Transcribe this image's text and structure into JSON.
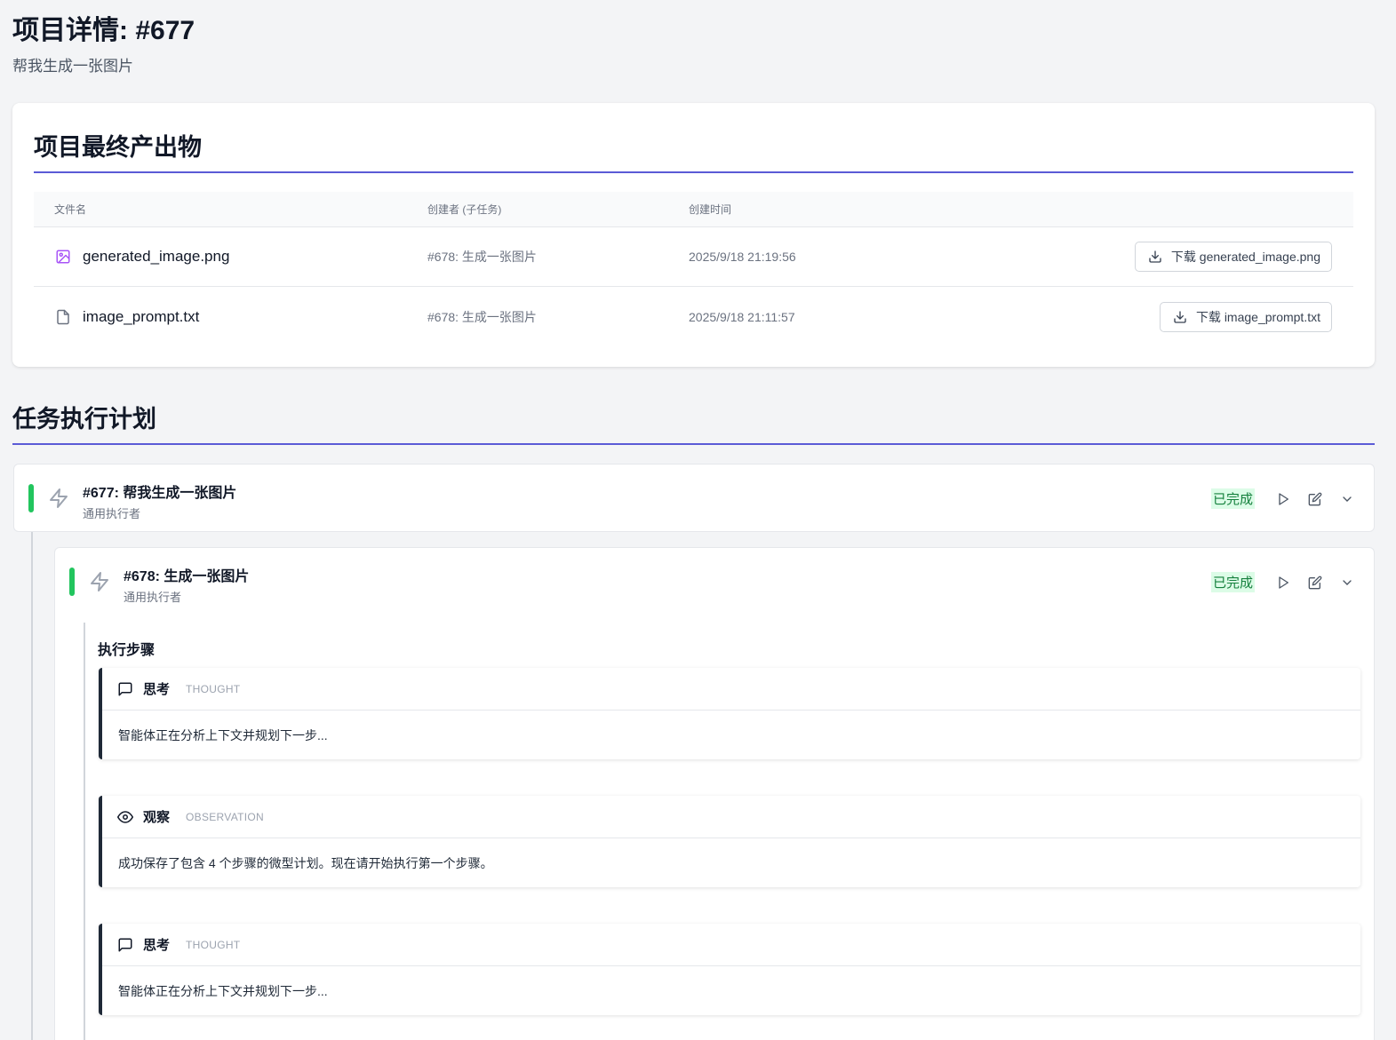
{
  "header": {
    "title": "项目详情: #677",
    "subtitle": "帮我生成一张图片"
  },
  "artifacts": {
    "title": "项目最终产出物",
    "columns": {
      "name": "文件名",
      "creator": "创建者 (子任务)",
      "time": "创建时间"
    },
    "files": [
      {
        "name": "generated_image.png",
        "icon": "image-file-icon",
        "creator": "#678: 生成一张图片",
        "time": "2025/9/18 21:19:56",
        "download_label": "下载 generated_image.png"
      },
      {
        "name": "image_prompt.txt",
        "icon": "text-file-icon",
        "creator": "#678: 生成一张图片",
        "time": "2025/9/18 21:11:57",
        "download_label": "下载 image_prompt.txt"
      }
    ]
  },
  "plan": {
    "title": "任务执行计划",
    "tasks": [
      {
        "title": "#677: 帮我生成一张图片",
        "executor": "通用执行者",
        "status": "已完成"
      },
      {
        "title": "#678: 生成一张图片",
        "executor": "通用执行者",
        "status": "已完成"
      }
    ],
    "steps_title": "执行步骤",
    "steps": [
      {
        "label": "思考",
        "type": "THOUGHT",
        "icon": "message-icon",
        "content": "智能体正在分析上下文并规划下一步..."
      },
      {
        "label": "观察",
        "type": "OBSERVATION",
        "icon": "eye-icon",
        "content": "成功保存了包含 4 个步骤的微型计划。现在请开始执行第一个步骤。"
      },
      {
        "label": "思考",
        "type": "THOUGHT",
        "icon": "message-icon",
        "content": "智能体正在分析上下文并规划下一步..."
      }
    ]
  },
  "colors": {
    "accent": "#5b5bd6",
    "success": "#22c55e",
    "badge_bg": "#dcfce7",
    "badge_text": "#15803d"
  }
}
